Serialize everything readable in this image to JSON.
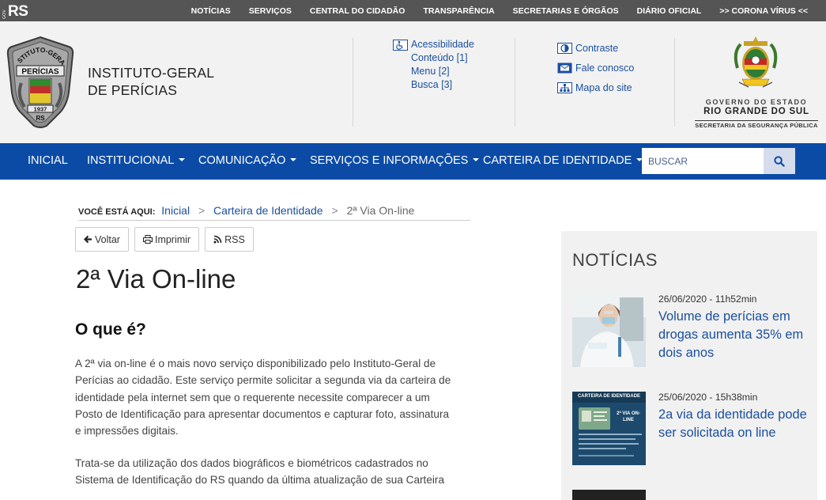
{
  "topbar": {
    "logo_small": "GOV",
    "logo_big": "RS",
    "links": [
      "NOTÍCIAS",
      "SERVIÇOS",
      "CENTRAL DO CIDADÃO",
      "TRANSPARÊNCIA",
      "SECRETARIAS E ÓRGÃOS",
      "DIÁRIO OFICIAL",
      ">> CORONA VÍRUS <<"
    ]
  },
  "header": {
    "badge": {
      "top_text": "INSTITUTO-GERAL",
      "mid_text": "PERÍCIAS",
      "year": "1937",
      "bottom_text": "RS"
    },
    "institute_line1": "INSTITUTO-GERAL",
    "institute_line2": "DE PERÍCIAS",
    "accessibility": {
      "title": "Acessibilidade",
      "items": [
        "Conteúdo [1]",
        "Menu [2]",
        "Busca [3]"
      ]
    },
    "links": [
      "Contraste",
      "Fale conosco",
      "Mapa do site"
    ],
    "gov": {
      "line1": "GOVERNO DO ESTADO",
      "line2": "RIO GRANDE DO SUL",
      "line3": "SECRETARIA DA SEGURANÇA PÚBLICA"
    }
  },
  "nav": {
    "items": [
      "INICIAL",
      "INSTITUCIONAL",
      "COMUNICAÇÃO",
      "SERVIÇOS E INFORMAÇÕES",
      "CARTEIRA DE IDENTIDADE"
    ],
    "search_placeholder": "BUSCAR"
  },
  "breadcrumb": {
    "label": "VOCÊ ESTÁ AQUI:",
    "items": [
      "Inicial",
      "Carteira de Identidade"
    ],
    "current": "2ª Via On-line",
    "separator": ">"
  },
  "actions": {
    "back": "Voltar",
    "print": "Imprimir",
    "rss": "RSS"
  },
  "content": {
    "title": "2ª Via On-line",
    "subtitle": "O que é?",
    "paragraphs": [
      [
        "A 2ª via on-line é o mais novo serviço disponibilizado pelo Instituto-Geral de",
        "Perícias ao cidadão. Este serviço permite solicitar a segunda via da carteira de",
        "identidade pela internet sem que o requerente necessite comparecer a um",
        "Posto de Identificação para apresentar documentos e capturar foto, assinatura",
        "e impressões digitais."
      ],
      [
        "Trata-se da utilização dos dados biográficos e biométricos cadastrados no",
        "Sistema de Identificação do RS quando da última atualização de sua Carteira"
      ]
    ]
  },
  "sidebar": {
    "title": "NOTÍCIAS",
    "news": [
      {
        "date": "26/06/2020 - 11h52min",
        "title": "Volume de perícias em drogas aumenta 35% em dois anos"
      },
      {
        "date": "25/06/2020 - 15h38min",
        "title": "2a via da identidade pode ser solicitada on line",
        "thumb_header": "CARTEIRA DE IDENTIDADE",
        "thumb_badge": "2ª VIA ON-LINE"
      }
    ]
  },
  "colors": {
    "topbar": "#555555",
    "nav": "#0b4ba6",
    "link": "#1b4fa0",
    "header_bg": "#f2f2f2"
  }
}
